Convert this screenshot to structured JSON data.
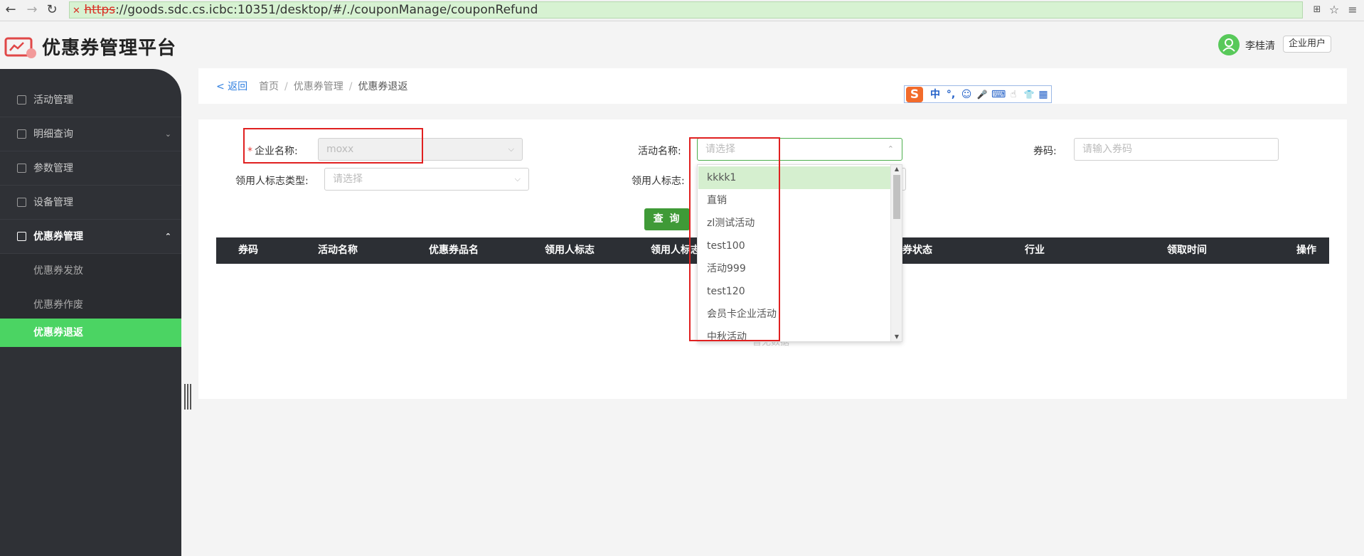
{
  "browser": {
    "url_insecure_mark": "✕",
    "url_protocol": "https",
    "url_rest": "://goods.sdc.cs.icbc:10351/desktop/#/./couponManage/couponRefund"
  },
  "header": {
    "app_title": "优惠券管理平台",
    "user_name": "李桂清",
    "user_role": "企业用户"
  },
  "sidebar": {
    "items": [
      {
        "label": "活动管理"
      },
      {
        "label": "明细查询"
      },
      {
        "label": "参数管理"
      },
      {
        "label": "设备管理"
      },
      {
        "label": "优惠券管理"
      }
    ],
    "sub_items": [
      {
        "label": "优惠券发放"
      },
      {
        "label": "优惠券作废"
      },
      {
        "label": "优惠券退返"
      }
    ]
  },
  "breadcrumb": {
    "back": "< 返回",
    "items": [
      "首页",
      "优惠券管理",
      "优惠券退返"
    ],
    "sep": "/"
  },
  "ime": {
    "logo": "S",
    "items": [
      "中",
      "°,",
      "☺",
      "🎤",
      "⌨",
      "☝",
      "👕",
      "▦"
    ]
  },
  "form": {
    "company_label": "企业名称:",
    "company_value": "moxx",
    "activity_label": "活动名称:",
    "activity_placeholder": "请选择",
    "code_label": "券码:",
    "code_placeholder": "请输入券码",
    "receiver_type_label": "领用人标志类型:",
    "receiver_type_placeholder": "请选择",
    "receiver_label": "领用人标志:",
    "query_button": "查 询"
  },
  "table": {
    "headers": [
      "券码",
      "活动名称",
      "优惠券品名",
      "领用人标志",
      "领用人标志",
      "券状态",
      "行业",
      "领取时间",
      "操作"
    ],
    "empty_text": "暂无数据"
  },
  "dropdown": {
    "options": [
      "kkkk1",
      "直销",
      "zl测试活动",
      "test100",
      "活动999",
      "test120",
      "会员卡企业活动",
      "中秋活动"
    ],
    "highlighted_index": 0
  },
  "colors": {
    "accent_green": "#4bd463",
    "query_green": "#3f9a37",
    "sidebar_bg": "#2f3136",
    "annotation_red": "#e02020"
  }
}
